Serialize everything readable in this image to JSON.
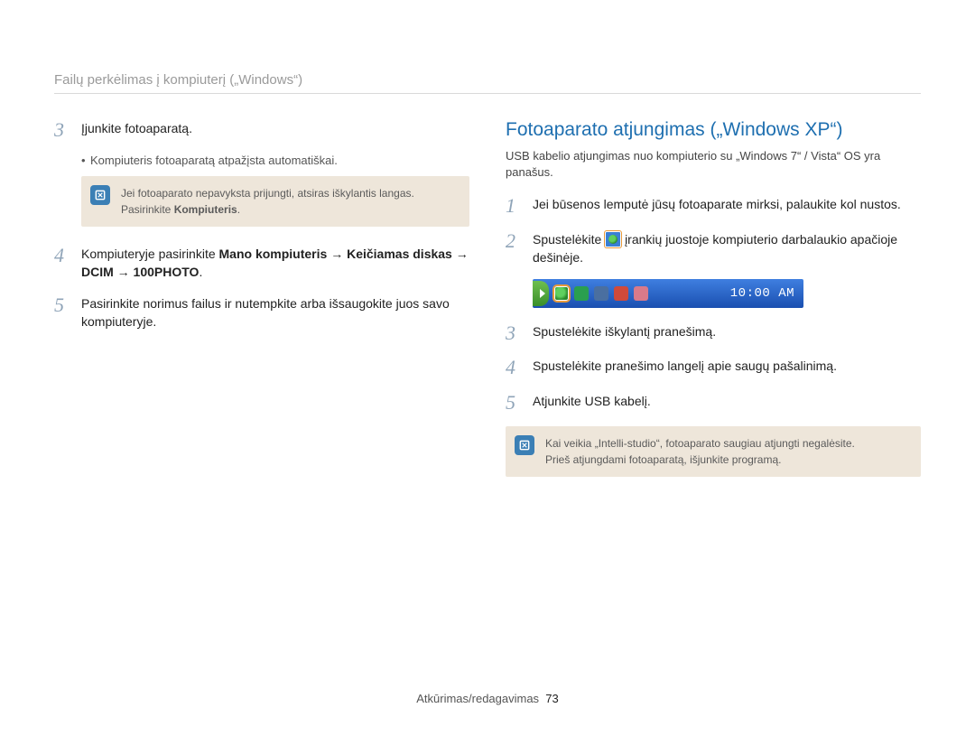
{
  "header": {
    "title": "Failų perkėlimas į kompiuterį („Windows“)"
  },
  "left": {
    "step3": {
      "num": "3",
      "text": "Įjunkite fotoaparatą."
    },
    "step3_sub": "Kompiuteris fotoaparatą atpažįsta automatiškai.",
    "note1_line1": "Jei fotoaparato nepavyksta prijungti, atsiras iškylantis langas.",
    "note1_line2_a": "Pasirinkite ",
    "note1_line2_b": "Kompiuteris",
    "note1_line2_c": ".",
    "step4": {
      "num": "4",
      "a": "Kompiuteryje pasirinkite ",
      "b": "Mano kompiuteris → Keičiamas diskas → DCIM → 100PHOTO",
      "c": "."
    },
    "step5": {
      "num": "5",
      "text": "Pasirinkite norimus failus ir nutempkite arba išsaugokite juos savo kompiuteryje."
    }
  },
  "right": {
    "heading": "Fotoaparato atjungimas („Windows XP“)",
    "sub": "USB kabelio atjungimas nuo kompiuterio su „Windows 7“ / Vista“ OS yra panašus.",
    "step1": {
      "num": "1",
      "text": "Jei būsenos lemputė jūsų fotoaparate mirksi, palaukite kol nustos."
    },
    "step2": {
      "num": "2",
      "a": "Spustelėkite ",
      "b": " įrankių juostoje kompiuterio darbalaukio apačioje dešinėje."
    },
    "taskbar_time": "10:00 AM",
    "step3": {
      "num": "3",
      "text": "Spustelėkite iškylantį pranešimą."
    },
    "step4": {
      "num": "4",
      "text": "Spustelėkite pranešimo langelį apie saugų pašalinimą."
    },
    "step5": {
      "num": "5",
      "text": "Atjunkite USB kabelį."
    },
    "note2_line1": "Kai veikia „Intelli-studio“, fotoaparato saugiau atjungti negalėsite.",
    "note2_line2": "Prieš atjungdami fotoaparatą, išjunkite programą."
  },
  "footer": {
    "section": "Atkūrimas/redagavimas",
    "page": "73"
  }
}
